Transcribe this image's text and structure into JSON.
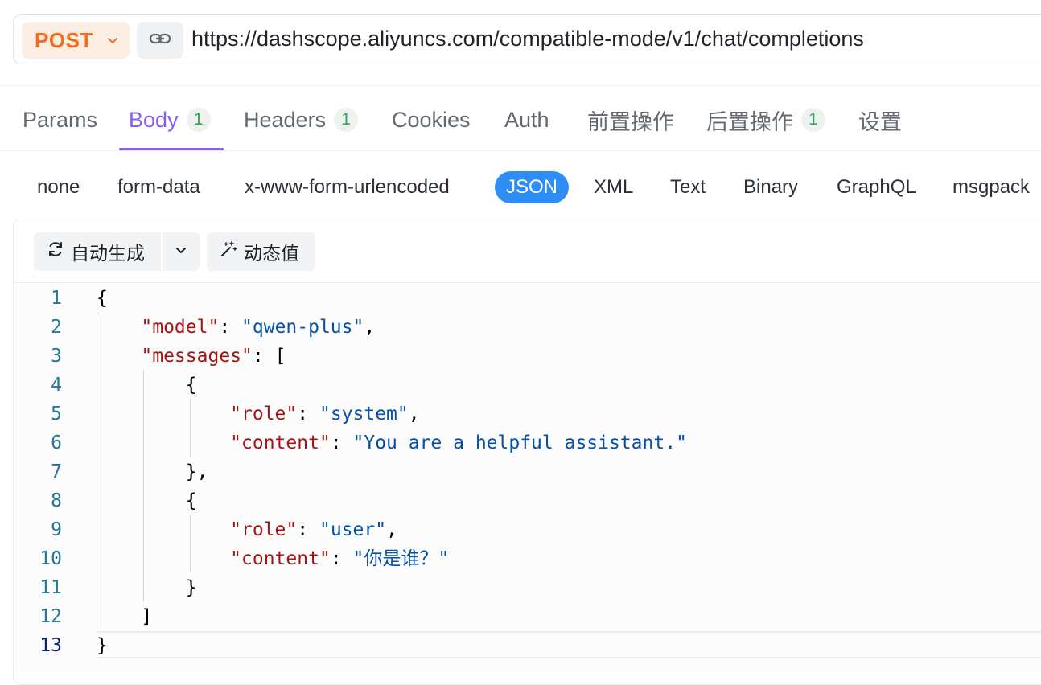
{
  "request": {
    "method": "POST",
    "url": "https://dashscope.aliyuncs.com/compatible-mode/v1/chat/completions"
  },
  "tabs": [
    {
      "label": "Params"
    },
    {
      "label": "Body",
      "badge": "1",
      "active": true
    },
    {
      "label": "Headers",
      "badge": "1"
    },
    {
      "label": "Cookies"
    },
    {
      "label": "Auth"
    },
    {
      "label": "前置操作"
    },
    {
      "label": "后置操作",
      "badge": "1"
    },
    {
      "label": "设置"
    }
  ],
  "body_types": [
    "none",
    "form-data",
    "x-www-form-urlencoded",
    "JSON",
    "XML",
    "Text",
    "Binary",
    "GraphQL",
    "msgpack"
  ],
  "body_type_selected": "JSON",
  "toolbar": {
    "auto_generate": "自动生成",
    "dynamic_value": "动态值"
  },
  "editor": {
    "current_line": 13,
    "lines": [
      "{",
      "    \"model\": \"qwen-plus\",",
      "    \"messages\": [",
      "        {",
      "            \"role\": \"system\",",
      "            \"content\": \"You are a helpful assistant.\"",
      "        },",
      "        {",
      "            \"role\": \"user\",",
      "            \"content\": \"你是谁？\"",
      "        }",
      "    ]",
      "}"
    ],
    "line_numbers": [
      "1",
      "2",
      "3",
      "4",
      "5",
      "6",
      "7",
      "8",
      "9",
      "10",
      "11",
      "12",
      "13"
    ]
  },
  "colors": {
    "method": "#f56c1e",
    "active_tab": "#8b5cf6",
    "badge_text": "#31a35b",
    "json_pill": "#2e8ef5",
    "json_key": "#a31515",
    "json_string": "#0451a5",
    "line_number": "#237893"
  },
  "icons": [
    "chevron-down-icon",
    "link-icon",
    "refresh-icon",
    "magic-wand-icon"
  ]
}
